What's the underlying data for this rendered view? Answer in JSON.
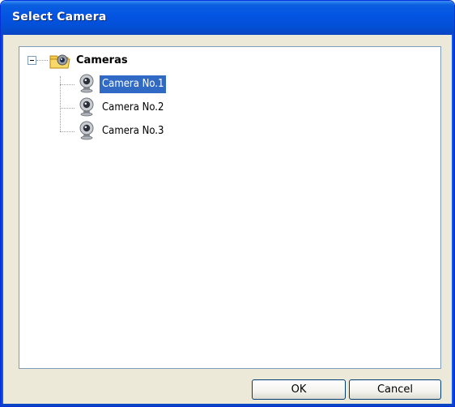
{
  "window": {
    "title": "Select Camera"
  },
  "tree": {
    "root": {
      "label": "Cameras",
      "icon": "camera-folder-icon",
      "expanded": true
    },
    "items": [
      {
        "label": "Camera No.1",
        "icon": "webcam-icon",
        "selected": true
      },
      {
        "label": "Camera No.2",
        "icon": "webcam-icon",
        "selected": false
      },
      {
        "label": "Camera No.3",
        "icon": "webcam-icon",
        "selected": false
      }
    ]
  },
  "buttons": {
    "ok_label": "OK",
    "cancel_label": "Cancel"
  },
  "colors": {
    "titlebar": "#0454e2",
    "selection": "#316ac5",
    "dialog_bg": "#ece9d8",
    "border": "#7f9db9"
  }
}
